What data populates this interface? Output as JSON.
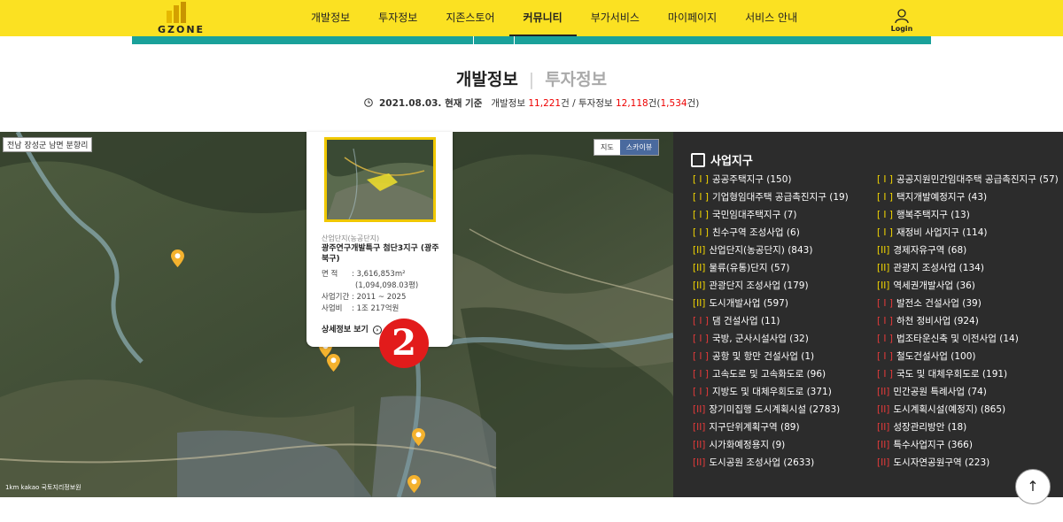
{
  "header": {
    "logo_text": "GZONE",
    "nav": [
      "개발정보",
      "투자정보",
      "지존스토어",
      "커뮤니티",
      "부가서비스",
      "마이페이지",
      "서비스 안내"
    ],
    "active_nav": "커뮤니티",
    "login_label": "Login"
  },
  "title": {
    "tab_dev": "개발정보",
    "tab_sep": "|",
    "tab_inv": "투자정보"
  },
  "status": {
    "date": "2021.08.03. 현재 기준",
    "dev_label": "개발정보",
    "dev_count": "11,221",
    "dev_unit": "건 / 투자정보",
    "inv_count": "12,118",
    "inv_unit": "건(",
    "inv_sub": "1,534",
    "inv_tail": "건)"
  },
  "map": {
    "region_label": "전남 장성군 남면 분향리",
    "toggle_road": "지도",
    "toggle_sky": "스카이뷰",
    "scale": "1km  kakao  국토지리정보원",
    "badge": "2"
  },
  "popup": {
    "category": "산업단지(농공단지)",
    "name": "광주연구개발특구 첨단3지구 (광주 북구)",
    "area_label": "면   적",
    "area_value": ": 3,616,853m²",
    "area_pyeong": "(1,094,098.03평)",
    "period_label": "사업기간",
    "period_value": ": 2011 ~ 2025",
    "cost_label": "사업비",
    "cost_value": ": 1조 217억원",
    "link": "상세정보 보기"
  },
  "panel": {
    "title": "사업지구",
    "col1": [
      {
        "code": "[ I ]",
        "color": "y",
        "label": "공공주택지구 (150)"
      },
      {
        "code": "[ I ]",
        "color": "y",
        "label": "기업형임대주택 공급촉진지구 (19)"
      },
      {
        "code": "[ I ]",
        "color": "y",
        "label": "국민임대주택지구 (7)"
      },
      {
        "code": "[ I ]",
        "color": "y",
        "label": "친수구역 조성사업 (6)"
      },
      {
        "code": "[II]",
        "color": "y",
        "label": "산업단지(농공단지) (843)"
      },
      {
        "code": "[II]",
        "color": "y",
        "label": "물류(유통)단지 (57)"
      },
      {
        "code": "[II]",
        "color": "y",
        "label": "관광단지 조성사업 (179)"
      },
      {
        "code": "[II]",
        "color": "y",
        "label": "도시개발사업 (597)"
      },
      {
        "code": "[ I ]",
        "color": "r",
        "label": "댐 건설사업 (11)"
      },
      {
        "code": "[ I ]",
        "color": "r",
        "label": "국방, 군사시설사업 (32)"
      },
      {
        "code": "[ I ]",
        "color": "r",
        "label": "공항 및 항만 건설사업 (1)"
      },
      {
        "code": "[ I ]",
        "color": "r",
        "label": "고속도로 및 고속화도로 (96)"
      },
      {
        "code": "[ I ]",
        "color": "r",
        "label": "지방도 및 대체우회도로 (371)"
      },
      {
        "code": "[II]",
        "color": "r",
        "label": "장기미집행 도시계획시설 (2783)"
      },
      {
        "code": "[II]",
        "color": "r",
        "label": "지구단위계획구역 (89)"
      },
      {
        "code": "[II]",
        "color": "r",
        "label": "시가화예정용지 (9)"
      },
      {
        "code": "[II]",
        "color": "r",
        "label": "도시공원 조성사업 (2633)"
      }
    ],
    "col2": [
      {
        "code": "[ I ]",
        "color": "y",
        "label": "공공지원민간임대주택 공급촉진지구 (57)"
      },
      {
        "code": "[ I ]",
        "color": "y",
        "label": "택지개발예정지구 (43)"
      },
      {
        "code": "[ I ]",
        "color": "y",
        "label": "행복주택지구 (13)"
      },
      {
        "code": "[ I ]",
        "color": "y",
        "label": "재정비 사업지구 (114)"
      },
      {
        "code": "[II]",
        "color": "y",
        "label": "경제자유구역 (68)"
      },
      {
        "code": "[II]",
        "color": "y",
        "label": "관광지 조성사업 (134)"
      },
      {
        "code": "[II]",
        "color": "y",
        "label": "역세권개발사업 (36)"
      },
      {
        "code": "[ I ]",
        "color": "r",
        "label": "발전소 건설사업 (39)"
      },
      {
        "code": "[ I ]",
        "color": "r",
        "label": "하천 정비사업 (924)"
      },
      {
        "code": "[ I ]",
        "color": "r",
        "label": "법조타운신축 및 이전사업 (14)"
      },
      {
        "code": "[ I ]",
        "color": "r",
        "label": "철도건설사업 (100)"
      },
      {
        "code": "[ I ]",
        "color": "r",
        "label": "국도 및 대체우회도로 (191)"
      },
      {
        "code": "[II]",
        "color": "r",
        "label": "민간공원 특례사업 (74)"
      },
      {
        "code": "[II]",
        "color": "r",
        "label": "도시계획시설(예정지) (865)"
      },
      {
        "code": "[II]",
        "color": "r",
        "label": "성장관리방안 (18)"
      },
      {
        "code": "[II]",
        "color": "r",
        "label": "특수사업지구 (366)"
      },
      {
        "code": "[II]",
        "color": "r",
        "label": "도시자연공원구역 (223)"
      }
    ]
  },
  "top_button": "↑"
}
